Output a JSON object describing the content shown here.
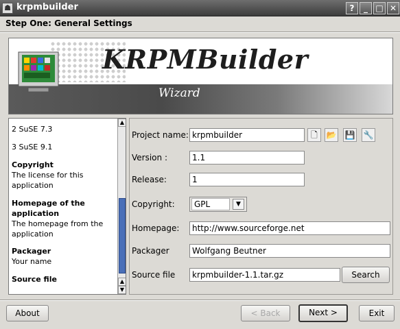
{
  "window": {
    "title": "krpmbuilder",
    "controls": [
      "?",
      "_",
      "□",
      "✕"
    ]
  },
  "step_title": "Step One: General Settings",
  "banner": {
    "brand": "KRPMBuilder",
    "subtitle": "Wizard"
  },
  "sidebar": {
    "items": [
      {
        "head": "",
        "text": "2 SuSE 7.3"
      },
      {
        "head": "",
        "text": "3 SuSE 9.1"
      },
      {
        "head": "Copyright",
        "text": "The license for this application"
      },
      {
        "head": "Homepage of the application",
        "text": "The homepage from the application"
      },
      {
        "head": "Packager",
        "text": "Your name"
      },
      {
        "head": "Source file",
        "text": ""
      }
    ]
  },
  "form": {
    "project_name": {
      "label": "Project name:",
      "value": "krpmbuilder"
    },
    "version": {
      "label": "Version :",
      "value": "1.1"
    },
    "release": {
      "label": "Release:",
      "value": "1"
    },
    "copyright": {
      "label": "Copyright:",
      "value": "GPL"
    },
    "homepage": {
      "label": "Homepage:",
      "value": "http://www.sourceforge.net"
    },
    "packager": {
      "label": "Packager",
      "value": "Wolfgang Beutner"
    },
    "source_file": {
      "label": "Source file",
      "value": "krpmbuilder-1.1.tar.gz"
    },
    "search_label": "Search"
  },
  "footer": {
    "about": "About",
    "back": "< Back",
    "next": "Next >",
    "exit": "Exit"
  }
}
